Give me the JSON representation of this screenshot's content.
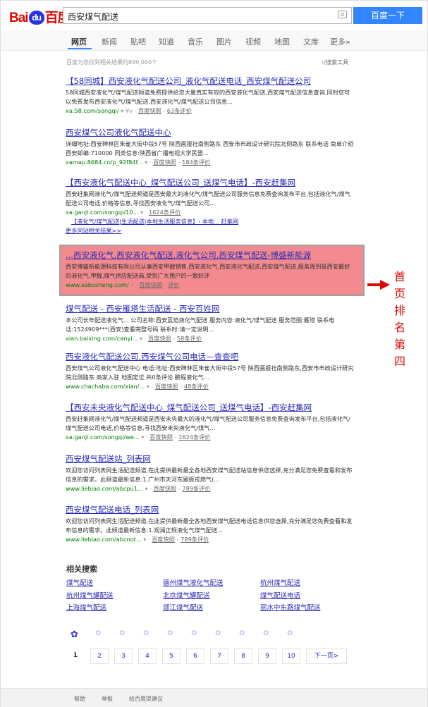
{
  "header": {
    "logo": {
      "bai": "Bai",
      "du": "du",
      "zh": "百度"
    },
    "search_value": "西安煤气配送",
    "search_button": "百度一下"
  },
  "nav": {
    "items": [
      "网页",
      "新闻",
      "贴吧",
      "知道",
      "音乐",
      "图片",
      "视频",
      "地图",
      "文库",
      "更多»"
    ],
    "active": "网页"
  },
  "stats": "百度为您找到相关结果约899,000个",
  "tools": "▽搜索工具",
  "results": [
    {
      "title": "【58同城】西安液化气配送公司_液化气配送电话_西安煤气配送公司",
      "abstract": "58同城西安液化气/煤气配送频道免费提供给您大量真实有效的西安液化气配送,西安煤气配送信息查询,同时您可以免费发布西安液化气/煤气配送,西安液化气/煤气配送公司信息...",
      "url": "xa.58.com/songqi/",
      "extra": "▾ ¥v ·",
      "snapshot": "百度快照",
      "reviews": "63条评价"
    },
    {
      "title": "西安煤气公司液化气配送中心",
      "abstract": "详细地址:西安碑林区朱雀大街中段57号 陕西画报社南侧路东 西安市市政设计研究院北侧路东 联系电话 简单介绍 西安邮编:710000 同类信息:陕西省广播电视大学民盟...",
      "url": "xamap.8684.cn/p_92f84f...",
      "extra": "▾ ·",
      "snapshot": "百度快照",
      "reviews": "184条评价"
    },
    {
      "title": "【西安液化气配送中心_煤气配送公司_送煤气电话】-西安赶集网",
      "abstract": "西安赶集网液化气/煤气配送频道是西安最大的液化气/煤气配送公司服务信息免费查询发布平台,包括液化气/煤气配送公司电话,价格等信息,寻找西安液化气/煤气配送公司...",
      "url": "xa.ganji.com/songqi/10...",
      "extra": "▾ ·",
      "snapshot": "",
      "reviews": "1624条评价",
      "sub_link_1": "【液化气/煤气配送|生活配送|本地生活服务信息】- 本地... 赶集网",
      "sub_link_2": "更多同站相关结果>>"
    },
    {
      "title": "...西安液化气,西安液化气配送,液化气公司,西安煤气配送-博盛新能源",
      "abstract": "西安博盛新能源科技有限公司从事西安甲醇销售,西安液化气,西安液化气配送,西安煤气配送,服务周到是西安最好的液化气,甲醇,煤气供应配送商,受到广大用户的一致好评",
      "url": "www.xabosheng.com/",
      "extra": "▾ ·",
      "snapshot": "百度快照",
      "reviews": "评价"
    },
    {
      "title": "煤气配送 - 西安雁塔生活配送 - 西安百姓网",
      "abstract": "本公司长年配送液化气... 公司名称:西安蓝焰液化气配送 服务内容:液化气/煤气配送 服务范围:雁塔 联系电话:1524909***(西安)查看完整号码 联系时:请一定说明...",
      "url": "xian.baixing.com/canyi...",
      "extra": "▾ ·",
      "snapshot": "百度快照",
      "reviews": "58条评价"
    },
    {
      "title": "西安液化气配送公司,西安煤气公司电话—查查吧",
      "abstract": "西安煤气公司液化气配送中心 电话:地址:西安碑林区朱雀大街中段57号 陕西画报社南侧路东,西安市市政设计研究院北侧路东 商家入驻 地图定位 共0条评论 鹏程液化气...",
      "url": "www.chachaba.com/xian/...",
      "extra": "▾ ·",
      "snapshot": "百度快照",
      "reviews": "48条评价"
    },
    {
      "title": "【西安未央液化气配送中心_煤气配送公司_送煤气电话】-西安赶集网",
      "abstract": "西安赶集网液化气/煤气配送频道是西安未央最大的液化气/煤气配送公司服务信息免费查询发布平台,包括液化气/煤气配送公司电话,价格等信息,寻找西安未央液化气/煤气...",
      "url": "xa.ganji.com/songqi/we...",
      "extra": "▾ ·",
      "snapshot": "百度快照",
      "reviews": "1624条评价"
    },
    {
      "title": "西安煤气配送站_列表网",
      "abstract": "欢迎您访问列表网生活配送频道,在此提供最新最全各地西安煤气配送站信息供您选择,充分满足您免费查看和发布信息的需求。此频道最新信息:1.广州市天河东圃振戎燃气(...",
      "url": "www.liebiao.com/abcpu1...",
      "extra": "▾ ·",
      "snapshot": "百度快照",
      "reviews": "789条评价"
    },
    {
      "title": "西安煤气配送电话_列表网",
      "abstract": "欢迎您访问列表网生活配送频道,在此提供最新最全各地西安煤气配送电话信息供您选择,充分满足您免费查看和发布信息的需求。此频道最新信息:1.观澜正规液化气煤气配送...",
      "url": "www.liebiao.com/abcnot...",
      "extra": "▾ ·",
      "snapshot": "百度快照",
      "reviews": "789条评价"
    }
  ],
  "annotation": "首页排名第四",
  "related": {
    "title": "相关搜索",
    "items": [
      "煤气配送",
      "德州煤气液化气配送",
      "杭州煤气配送",
      "杭州煤气罐配送",
      "北京煤气罐配送",
      "煤气配送电话",
      "上海煤气配送",
      "郯江煤气配送",
      "丽水中东路煤气配送"
    ]
  },
  "pager": {
    "current": "1",
    "pages": [
      "2",
      "3",
      "4",
      "5",
      "6",
      "7",
      "8",
      "9",
      "10"
    ],
    "next": "下一页>"
  },
  "footer": {
    "items": [
      "帮助",
      "举报",
      "给百度提建议"
    ]
  },
  "colors": {
    "accent": "#3385ff",
    "link": "#2a2ab8",
    "url": "#008000",
    "highlight": "#f28a8f",
    "annotation": "#e10601"
  }
}
